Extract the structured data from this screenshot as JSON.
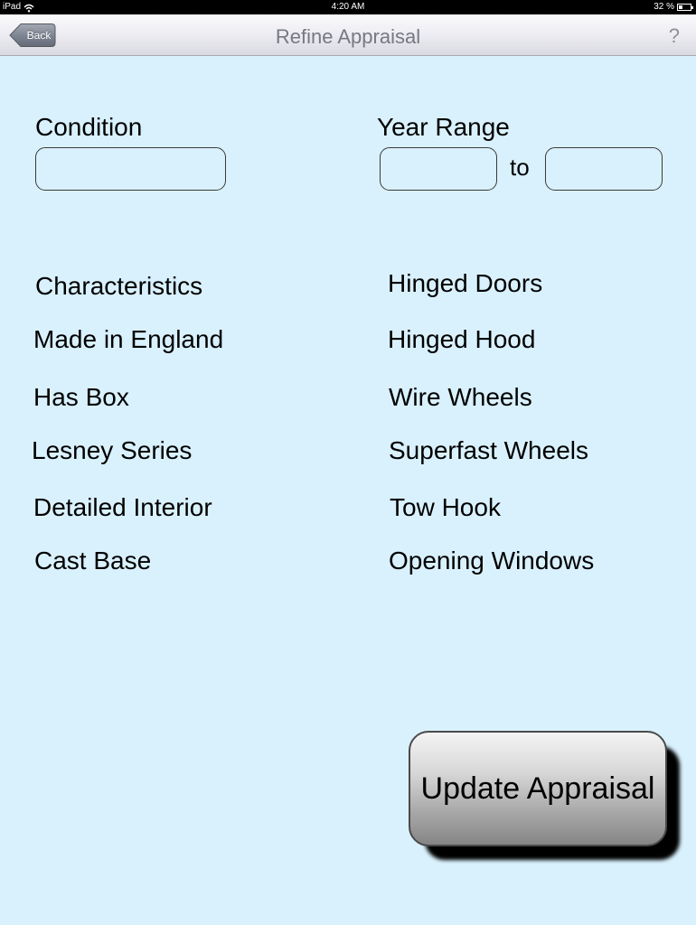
{
  "status_bar": {
    "carrier": "iPad",
    "time": "4:20 AM",
    "battery_text": "32 %",
    "battery_level": 0.32
  },
  "nav": {
    "back_label": "Back",
    "title": "Refine Appraisal",
    "help_label": "?"
  },
  "form": {
    "condition_label": "Condition",
    "condition_value": "",
    "year_range_label": "Year Range",
    "year_from_value": "",
    "year_separator": "to",
    "year_to_value": ""
  },
  "characteristics": {
    "heading": "Characteristics",
    "left_items": [
      "Made in England",
      "Has Box",
      "Lesney Series",
      "Detailed Interior",
      "Cast Base"
    ],
    "right_items": [
      "Hinged Doors",
      "Hinged Hood",
      "Wire Wheels",
      "Superfast Wheels",
      "Tow Hook",
      "Opening Windows"
    ]
  },
  "update_button_label": "Update Appraisal",
  "icons": {
    "wifi": "wifi-icon",
    "battery": "battery-icon",
    "back": "back-arrow-button"
  },
  "colors": {
    "background": "#d9f1fd",
    "nav_title": "#767a80",
    "back_button": "#7d8491"
  }
}
